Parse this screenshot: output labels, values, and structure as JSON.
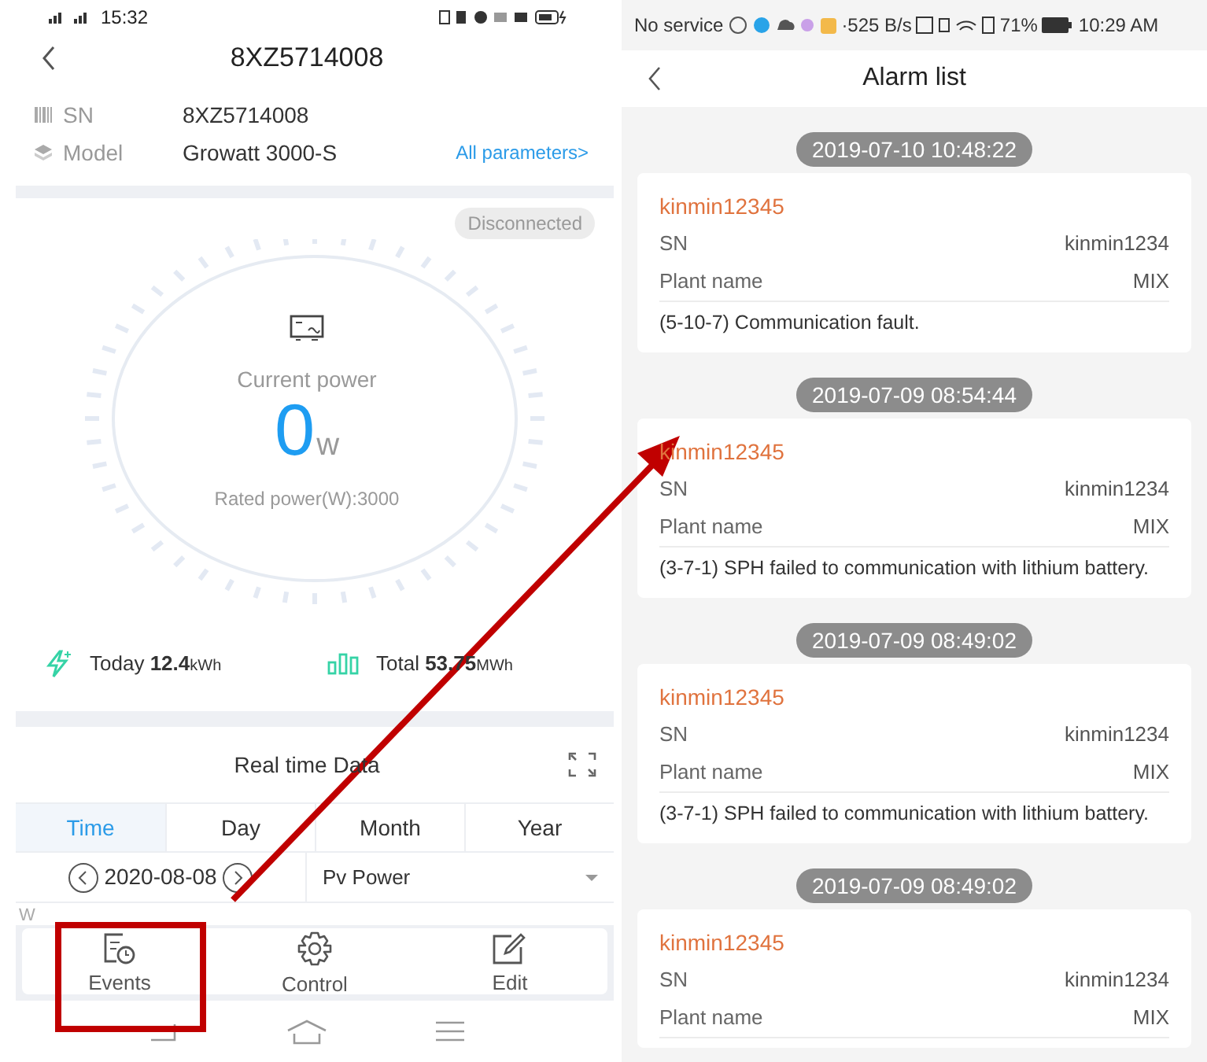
{
  "left_screen": {
    "status_bar": {
      "time": "15:32"
    },
    "header": {
      "title": "8XZ5714008"
    },
    "device_info": [
      {
        "kind": "sn",
        "label": "SN",
        "value": "8XZ5714008"
      },
      {
        "kind": "model",
        "label": "Model",
        "value": "Growatt 3000-S"
      }
    ],
    "all_parameters_link": "All parameters>",
    "status_badge": "Disconnected",
    "gauge": {
      "label": "Current power",
      "value": "0",
      "unit": "w",
      "rated": "Rated power(W):3000"
    },
    "totals": [
      {
        "kind": "today",
        "label": "Today",
        "value": "12.4",
        "unit": "kWh"
      },
      {
        "kind": "total",
        "label": "Total",
        "value": "53.75",
        "unit": "MWh"
      }
    ],
    "real_time": {
      "title": "Real time Data",
      "tabs": [
        {
          "label": "Time",
          "selected": true
        },
        {
          "label": "Day",
          "selected": false
        },
        {
          "label": "Month",
          "selected": false
        },
        {
          "label": "Year",
          "selected": false
        }
      ],
      "date": "2020-08-08",
      "metric": "Pv Power",
      "axis_label": "W"
    },
    "actions": [
      {
        "kind": "events",
        "label": "Events",
        "highlighted": true
      },
      {
        "kind": "control",
        "label": "Control",
        "highlighted": false
      },
      {
        "kind": "edit",
        "label": "Edit",
        "highlighted": false
      }
    ]
  },
  "right_screen": {
    "status_bar": {
      "carrier": "No service",
      "speed": "·525 B/s",
      "battery": "71%",
      "time": "10:29 AM"
    },
    "header": {
      "title": "Alarm list"
    },
    "alarms": [
      {
        "timestamp": "2019-07-10 10:48:22",
        "user": "kinmin12345",
        "sn_label": "SN",
        "sn": "kinmin1234",
        "plant_label": "Plant name",
        "plant": "MIX",
        "message": "(5-10-7) Communication fault."
      },
      {
        "timestamp": "2019-07-09 08:54:44",
        "user": "kinmin12345",
        "sn_label": "SN",
        "sn": "kinmin1234",
        "plant_label": "Plant name",
        "plant": "MIX",
        "message": "(3-7-1) SPH failed to communication with lithium battery."
      },
      {
        "timestamp": "2019-07-09 08:49:02",
        "user": "kinmin12345",
        "sn_label": "SN",
        "sn": "kinmin1234",
        "plant_label": "Plant name",
        "plant": "MIX",
        "message": "(3-7-1) SPH failed to communication with lithium battery."
      },
      {
        "timestamp": "2019-07-09 08:49:02",
        "user": "kinmin12345",
        "sn_label": "SN",
        "sn": "kinmin1234",
        "plant_label": "Plant name",
        "plant": "MIX"
      }
    ]
  }
}
